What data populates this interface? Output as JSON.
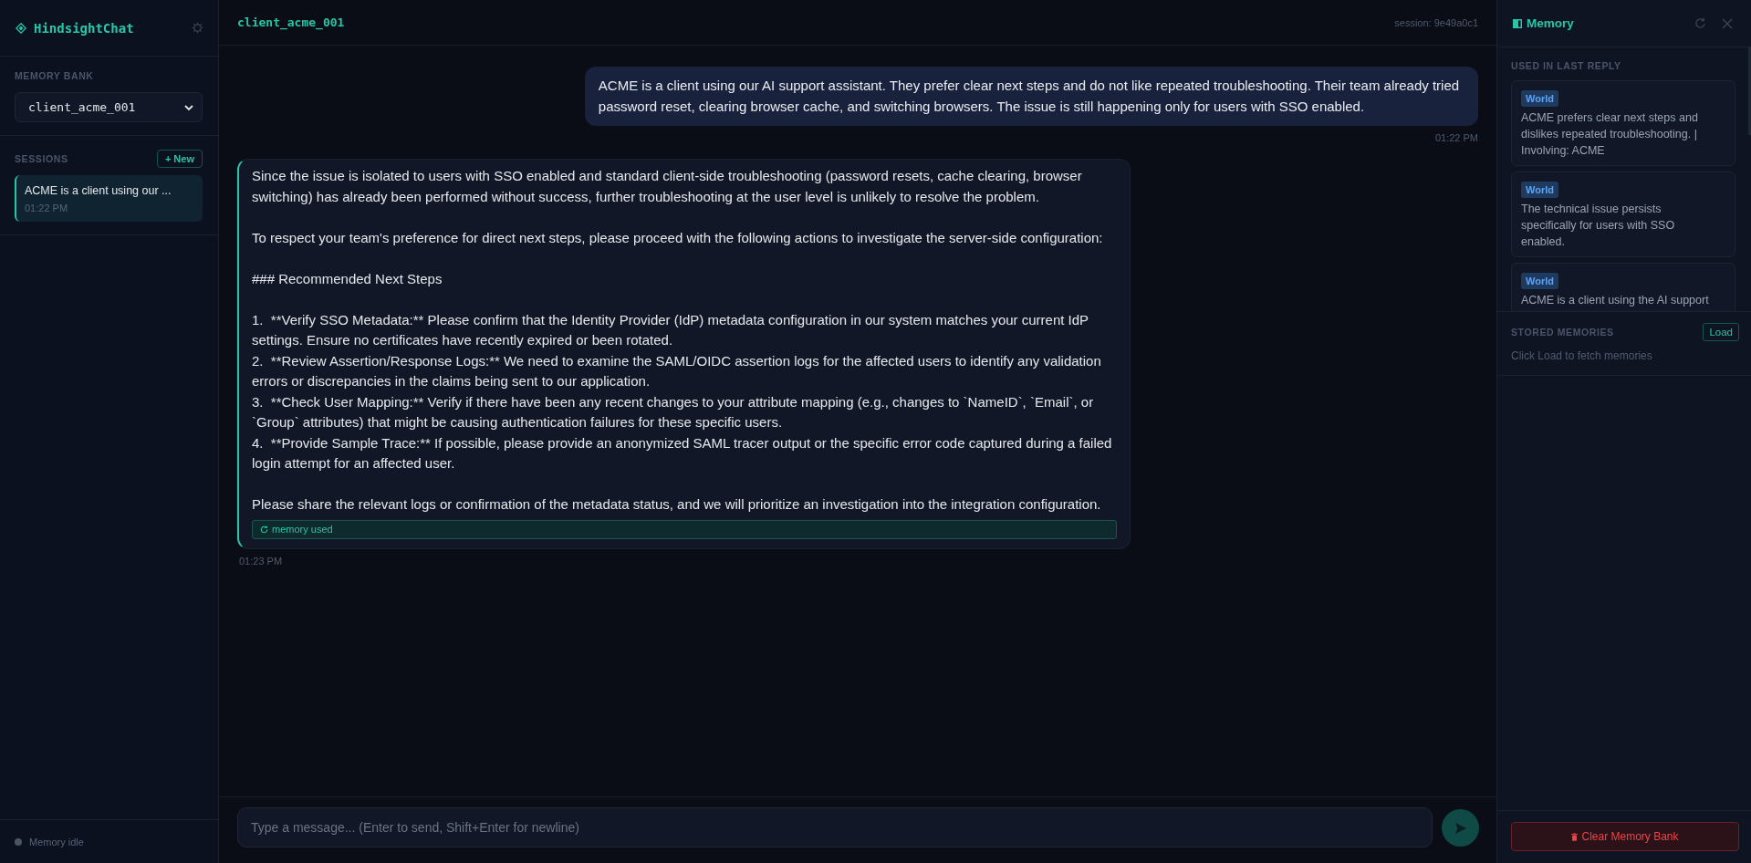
{
  "sidebar": {
    "app_title": "HindsightChat",
    "memory_bank": {
      "label": "MEMORY BANK",
      "value": "client_acme_001"
    },
    "sessions": {
      "label": "SESSIONS",
      "new_button": "+ New",
      "items": [
        {
          "title": "ACME is a client using our ...",
          "time": "01:22 PM",
          "selected": true
        }
      ]
    },
    "status": {
      "text": "Memory idle",
      "active": false
    }
  },
  "chat": {
    "title": "client_acme_001",
    "session": "session: 9e49a0c1",
    "messages": [
      {
        "kind": "user",
        "paragraphs": [
          [
            "ACME is a client using our AI support assistant. They prefer clear next steps and do not like repeated troubleshooting. Their team already tried password reset, clearing browser cache, and switching browsers. The issue is still happening only for users with SSO enabled."
          ]
        ],
        "time": "01:22 PM"
      },
      {
        "kind": "assistant",
        "paragraphs": [
          [
            "Since the issue is isolated to users with SSO enabled and standard client-side troubleshooting (password resets, cache clearing, browser switching) has already been performed without success, further troubleshooting at the user level is unlikely to resolve the problem."
          ],
          [
            "To respect your team's preference for direct next steps, please proceed with the following actions to investigate the server-side configuration:"
          ],
          [
            "### Recommended Next Steps"
          ],
          [
            "1.  **Verify SSO Metadata:** Please confirm that the Identity Provider (IdP) metadata configuration in our system matches your current IdP settings. Ensure no certificates have recently expired or been rotated.",
            "2.  **Review Assertion/Response Logs:** We need to examine the SAML/OIDC assertion logs for the affected users to identify any validation errors or discrepancies in the claims being sent to our application.",
            "3.  **Check User Mapping:** Verify if there have been any recent changes to your attribute mapping (e.g., changes to `NameID`, `Email`, or `Group` attributes) that might be causing authentication failures for these specific users.",
            "4.  **Provide Sample Trace:** If possible, please provide an anonymized SAML tracer output or the specific error code captured during a failed login attempt for an affected user."
          ],
          [
            "Please share the relevant logs or confirmation of the metadata status, and we will prioritize an investigation into the integration configuration."
          ]
        ],
        "memory_tag": "memory used",
        "time": "01:23 PM"
      }
    ],
    "composer": {
      "placeholder": "Type a message... (Enter to send, Shift+Enter for newline)"
    }
  },
  "memory_panel": {
    "title": "Memory",
    "used_label": "USED IN LAST REPLY",
    "used": [
      {
        "type": "World",
        "text": "ACME prefers clear next steps and dislikes repeated troubleshooting. | Involving: ACME"
      },
      {
        "type": "World",
        "text": "The technical issue persists specifically for users with SSO enabled."
      },
      {
        "type": "World",
        "text": "ACME is a client using the AI support"
      }
    ],
    "stored_label": "STORED MEMORIES",
    "load_button": "Load",
    "stored_hint": "Click Load to fetch memories",
    "clear_button": "Clear Memory Bank"
  }
}
